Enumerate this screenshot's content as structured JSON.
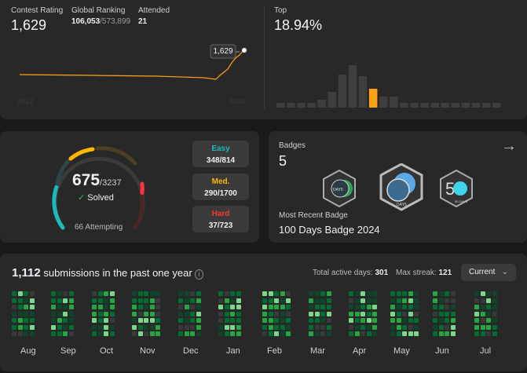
{
  "rating": {
    "label": "Contest Rating",
    "value": "1,629",
    "global_label": "Global Ranking",
    "global_rank": "106,053",
    "global_total": "/573,899",
    "attended_label": "Attended",
    "attended_value": "21",
    "tooltip": "1,629",
    "year_start": "2022",
    "year_end": "2024"
  },
  "top": {
    "label": "Top",
    "value": "18.94%",
    "highlight_color": "#ffa116",
    "bar_color": "#3e3e3e"
  },
  "solved": {
    "count": "675",
    "total": "/3237",
    "solved_label": "Solved",
    "attempting": "66 Attempting",
    "easy": {
      "label": "Easy",
      "value": "348/814",
      "color": "#1cbaba"
    },
    "medium": {
      "label": "Med.",
      "value": "290/1700",
      "color": "#ffb700"
    },
    "hard": {
      "label": "Hard",
      "value": "37/723",
      "color": "#f63737"
    }
  },
  "badges": {
    "label": "Badges",
    "count": "5",
    "recent_label": "Most Recent Badge",
    "recent_name": "100 Days Badge 2024",
    "items": [
      "DAY5",
      "DAY5",
      "50 DAYS"
    ]
  },
  "submissions": {
    "count": "1,112",
    "label": "submissions in the past one year",
    "active_label": "Total active days:",
    "active_value": "301",
    "streak_label": "Max streak:",
    "streak_value": "121",
    "dropdown": "Current",
    "months": [
      "Aug",
      "Sep",
      "Oct",
      "Nov",
      "Dec",
      "Jan",
      "Feb",
      "Mar",
      "Apr",
      "May",
      "Jun",
      "Jul"
    ]
  }
}
